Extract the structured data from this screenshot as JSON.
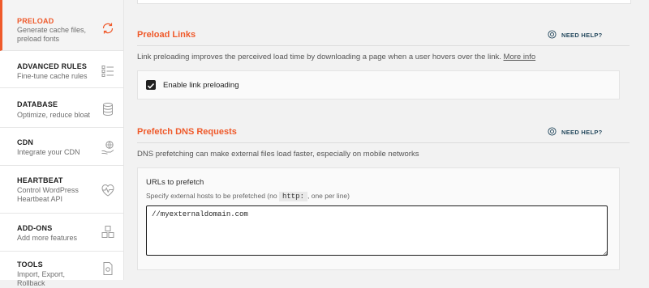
{
  "sidebar": {
    "items": [
      {
        "title": "PRELOAD",
        "sub": "Generate cache files, preload fonts",
        "icon": "refresh-icon",
        "active": true
      },
      {
        "title": "ADVANCED RULES",
        "sub": "Fine-tune cache rules",
        "icon": "list-icon"
      },
      {
        "title": "DATABASE",
        "sub": "Optimize, reduce bloat",
        "icon": "database-icon"
      },
      {
        "title": "CDN",
        "sub": "Integrate your CDN",
        "icon": "cdn-hand-icon"
      },
      {
        "title": "HEARTBEAT",
        "sub": "Control WordPress Heartbeat API",
        "icon": "heartbeat-icon"
      },
      {
        "title": "ADD-ONS",
        "sub": "Add more features",
        "icon": "cubes-icon"
      },
      {
        "title": "TOOLS",
        "sub": "Import, Export, Rollback",
        "icon": "tools-doc-icon"
      }
    ]
  },
  "preload_links": {
    "title": "Preload Links",
    "help": "NEED HELP?",
    "description": "Link preloading improves the perceived load time by downloading a page when a user hovers over the link.",
    "more_info": "More info",
    "checkbox_label": "Enable link preloading",
    "checked": true
  },
  "prefetch": {
    "title": "Prefetch DNS Requests",
    "help": "NEED HELP?",
    "description": "DNS prefetching can make external files load faster, especially on mobile networks",
    "field_title": "URLs to prefetch",
    "field_help_before": "Specify external hosts to be prefetched (no",
    "field_help_code": "http:",
    "field_help_after": ", one per line)",
    "textarea_value": "//myexternaldomain.com"
  },
  "colors": {
    "accent": "#ef5a2b",
    "help": "#264a5f"
  }
}
